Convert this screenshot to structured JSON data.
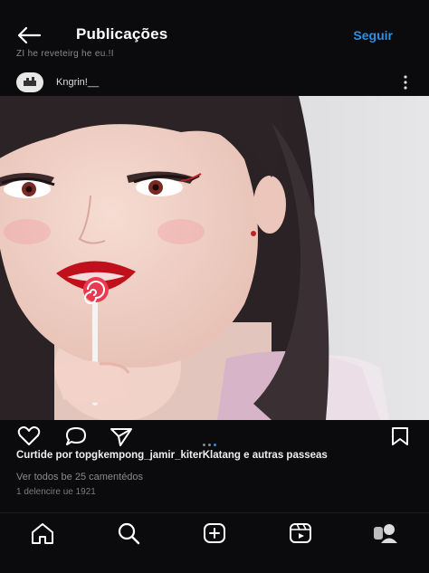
{
  "header": {
    "title": "Publicações",
    "follow_label": "Seguir",
    "subline": "ZI he reveteirg he eu.!I"
  },
  "post": {
    "username": "Kngrin!__",
    "likes_text": "Curtide por topgkempong_jamir_kiterKlatang e autras passeas",
    "comments_text": "Ver todos be 25 camentédos",
    "date_text": "1 delencire ue 1921",
    "carousel": {
      "count": 3,
      "active": 2
    }
  },
  "nav": {
    "items": [
      "home-icon",
      "search-icon",
      "new-post-icon",
      "reels-icon",
      "profile-icon"
    ]
  },
  "colors": {
    "background": "#0b0b0d",
    "accent": "#2f8fe0",
    "muted_text": "#8a8a8e"
  }
}
